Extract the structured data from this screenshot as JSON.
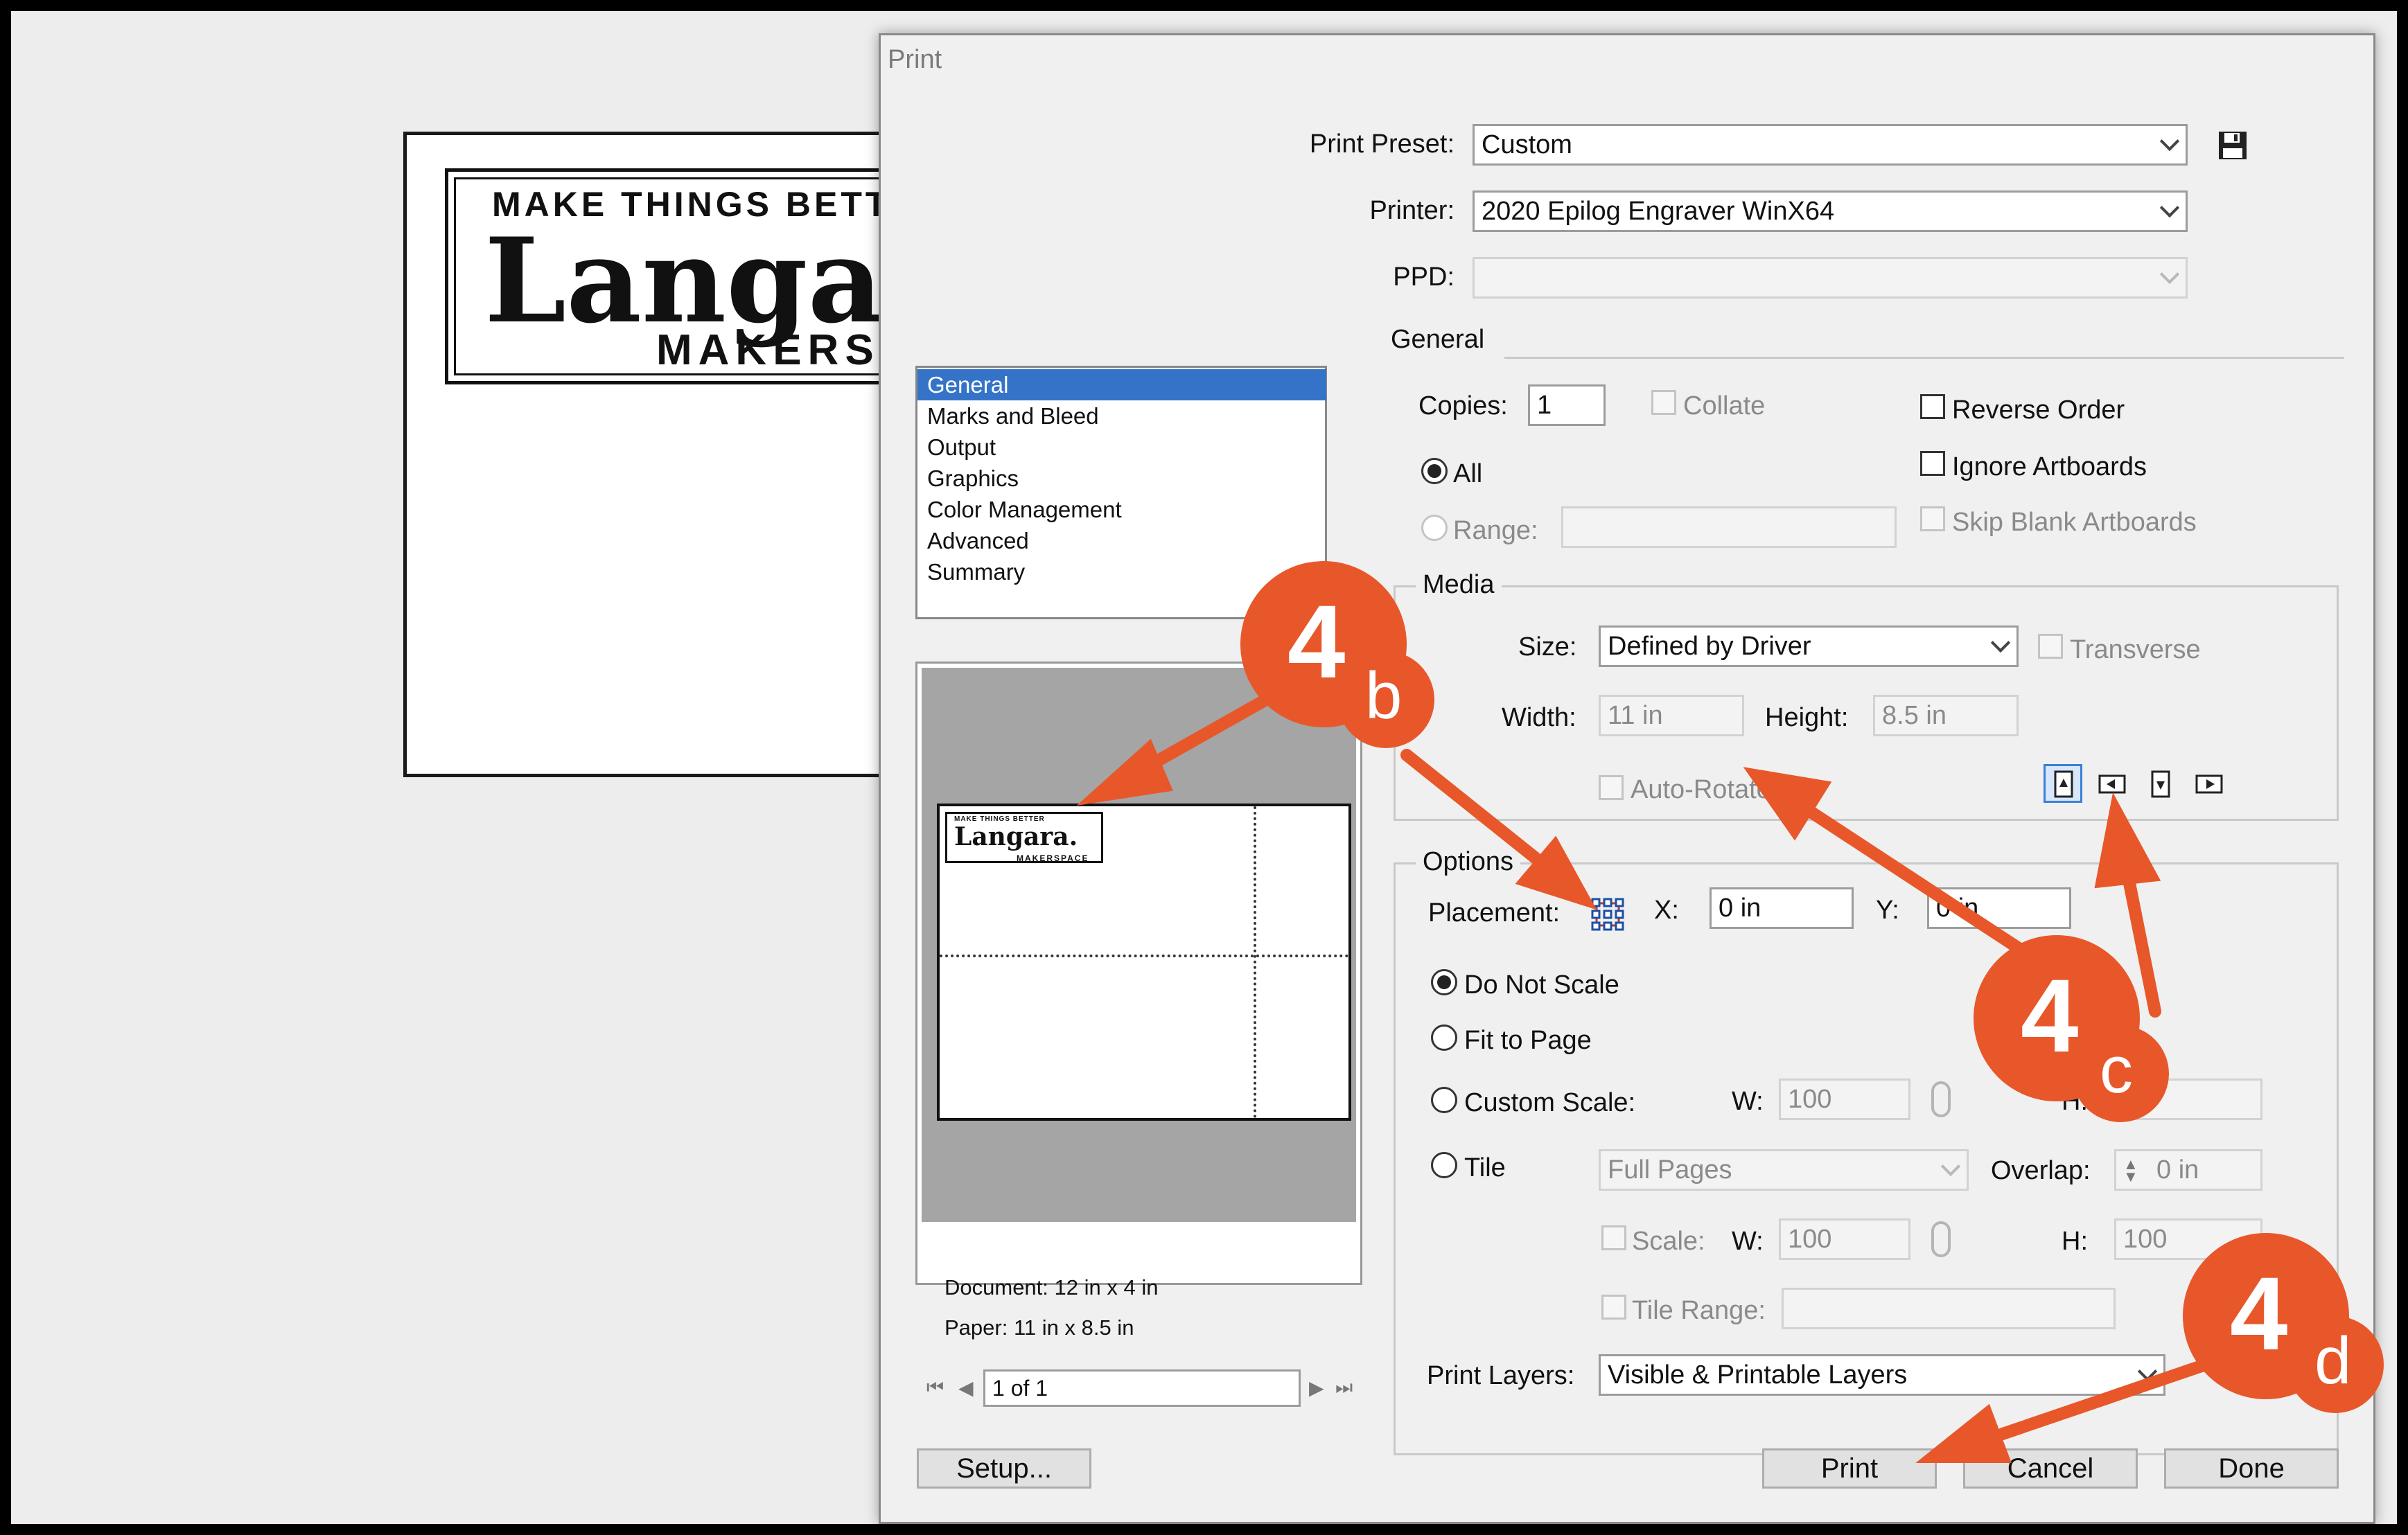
{
  "artboard": {
    "logo_tagline": "MAKE THINGS BETTER",
    "logo_word": "Langara",
    "logo_sub": "MAKERS"
  },
  "dialog": {
    "title": "Print",
    "print_preset_label": "Print Preset:",
    "print_preset_value": "Custom",
    "printer_label": "Printer:",
    "printer_value": "2020 Epilog Engraver WinX64",
    "ppd_label": "PPD:",
    "ppd_value": "",
    "nav": [
      "General",
      "Marks and Bleed",
      "Output",
      "Graphics",
      "Color Management",
      "Advanced",
      "Summary"
    ],
    "nav_selected": "General",
    "general": {
      "section": "General",
      "copies_label": "Copies:",
      "copies_value": "1",
      "collate": "Collate",
      "reverse_order": "Reverse Order",
      "all": "All",
      "ignore_artboards": "Ignore Artboards",
      "range": "Range:",
      "skip_blank_artboards": "Skip Blank Artboards"
    },
    "media": {
      "section": "Media",
      "size_label": "Size:",
      "size_value": "Defined by Driver",
      "transverse": "Transverse",
      "width_label": "Width:",
      "width_value": "11 in",
      "height_label": "Height:",
      "height_value": "8.5 in",
      "auto_rotate": "Auto-Rotate"
    },
    "options": {
      "section": "Options",
      "placement_label": "Placement:",
      "x_label": "X:",
      "x_value": "0 in",
      "y_label": "Y:",
      "y_value": "0 in",
      "do_not_scale": "Do Not Scale",
      "fit_to_page": "Fit to Page",
      "custom_scale": "Custom Scale:",
      "w_label": "W:",
      "w_value": "100",
      "h_label": "H:",
      "h_value": "",
      "tile": "Tile",
      "tile_value": "Full Pages",
      "overlap_label": "Overlap:",
      "overlap_value": "0 in",
      "scale": "Scale:",
      "scale_w_label": "W:",
      "scale_w_value": "100",
      "scale_h_label": "H:",
      "scale_h_value": "100",
      "tile_range": "Tile Range:",
      "print_layers_label": "Print Layers:",
      "print_layers_value": "Visible & Printable Layers"
    },
    "preview": {
      "document": "Document: 12 in x 4 in",
      "paper": "Paper: 11 in x 8.5 in",
      "page": "1 of 1",
      "mini_tagline": "MAKE THINGS BETTER",
      "mini_word": "Langara.",
      "mini_sub": "MAKERSPACE"
    },
    "buttons": {
      "setup": "Setup...",
      "print": "Print",
      "cancel": "Cancel",
      "done": "Done"
    }
  },
  "callouts": [
    {
      "number": "4",
      "letter": "b"
    },
    {
      "number": "4",
      "letter": "c"
    },
    {
      "number": "4",
      "letter": "d"
    }
  ],
  "colors": {
    "callout": "#e8572a",
    "selection": "#3473c8"
  }
}
